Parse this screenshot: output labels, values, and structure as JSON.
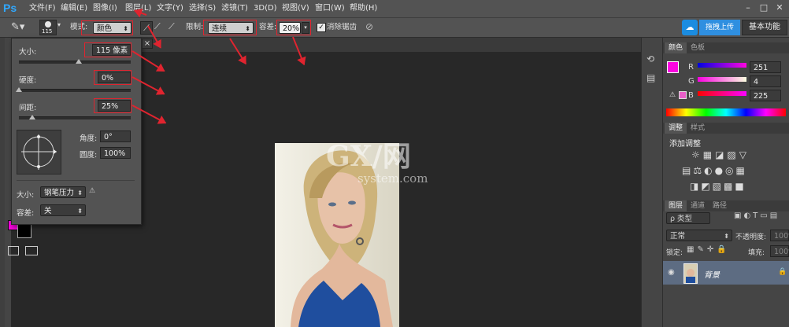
{
  "app": {
    "logo": "Ps"
  },
  "menu": [
    "文件(F)",
    "编辑(E)",
    "图像(I)",
    "图层(L)",
    "文字(Y)",
    "选择(S)",
    "滤镜(T)",
    "3D(D)",
    "视图(V)",
    "窗口(W)",
    "帮助(H)"
  ],
  "window_controls": [
    "–",
    "□",
    "✕"
  ],
  "options": {
    "brush_size": "115",
    "mode_label": "模式:",
    "mode_value": "颜色",
    "limit_label": "限制:",
    "limit_value": "连续",
    "tolerance_label": "容差:",
    "tolerance_value": "20%",
    "antialias_label": "消除锯齿",
    "upload_label": "拖拽上传",
    "workspace_label": "基本功能"
  },
  "brush_panel": {
    "size_label": "大小:",
    "size_value": "115 像素",
    "hardness_label": "硬度:",
    "hardness_value": "0%",
    "spacing_label": "间距:",
    "spacing_value": "25%",
    "angle_label": "角度:",
    "angle_value": "0°",
    "roundness_label": "圆度:",
    "roundness_value": "100%",
    "pressure_label": "大小:",
    "pressure_value": "钢笔压力",
    "tol_label": "容差:",
    "tol_value": "关",
    "close": "×"
  },
  "color_panel": {
    "tabs": [
      "颜色",
      "色板"
    ],
    "r_label": "R",
    "r_value": "251",
    "g_label": "G",
    "g_value": "4",
    "b_label": "B",
    "b_value": "225",
    "foreground_color": "#fb04e1",
    "background_color": "#000000"
  },
  "adjust_panel": {
    "tabs": [
      "调整",
      "样式"
    ],
    "title": "添加调整"
  },
  "layers_panel": {
    "tabs": [
      "图层",
      "通道",
      "路径"
    ],
    "filter_label": "ρ 类型",
    "blend_mode": "正常",
    "opacity_label": "不透明度:",
    "opacity_value": "100%",
    "lock_label": "锁定:",
    "fill_label": "填充:",
    "fill_value": "100%",
    "layer_name": "背景"
  },
  "watermark": {
    "brand": "GX/网",
    "site": "system.com"
  }
}
